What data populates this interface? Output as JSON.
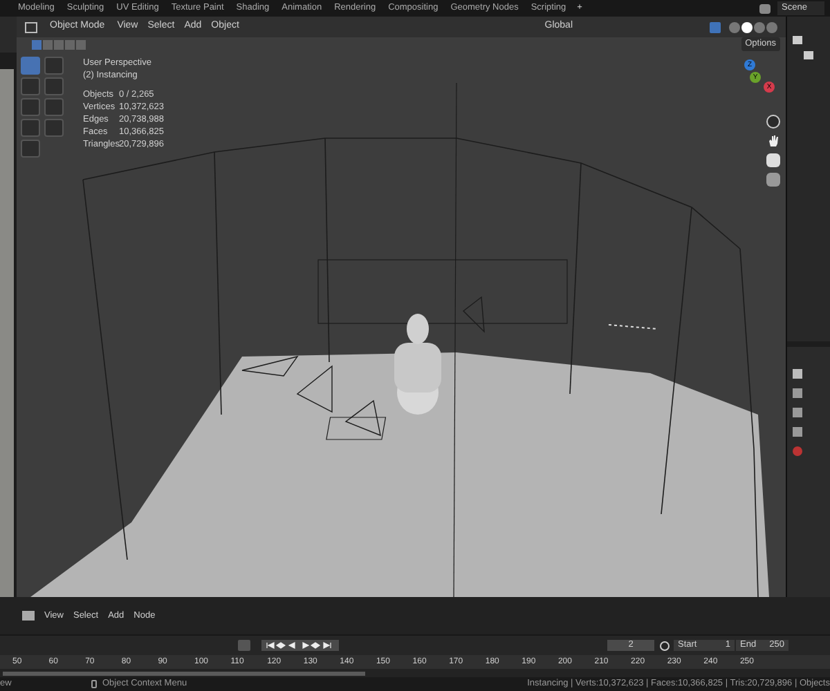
{
  "workspace_tabs": [
    {
      "label": "Modeling",
      "selected": false
    },
    {
      "label": "Sculpting",
      "selected": false
    },
    {
      "label": "UV Editing",
      "selected": false
    },
    {
      "label": "Texture Paint",
      "selected": false
    },
    {
      "label": "Shading",
      "selected": false
    },
    {
      "label": "Animation",
      "selected": false
    },
    {
      "label": "Rendering",
      "selected": false
    },
    {
      "label": "Compositing",
      "selected": false
    },
    {
      "label": "Geometry Nodes",
      "selected": false
    },
    {
      "label": "Scripting",
      "selected": false
    }
  ],
  "add_tab": "+",
  "scene": "Scene",
  "viewport": {
    "mode": "Object Mode",
    "menus": [
      "View",
      "Select",
      "Add",
      "Object"
    ],
    "orientation": "Global",
    "options": "Options",
    "select_modes": [
      {
        "selected": true
      },
      {
        "selected": false
      },
      {
        "selected": false
      },
      {
        "selected": false
      },
      {
        "selected": false
      }
    ],
    "shading_modes": [
      {
        "selected": false
      },
      {
        "selected": true
      },
      {
        "selected": false
      },
      {
        "selected": false
      }
    ],
    "tools": [
      {
        "selected": true
      },
      {
        "selected": false
      },
      {
        "selected": false
      },
      {
        "selected": false
      },
      {
        "selected": false
      },
      {
        "selected": false
      },
      {
        "selected": false
      },
      {
        "selected": false
      },
      {
        "selected": false
      }
    ],
    "view_name": "User Perspective",
    "collection": "(2) Instancing",
    "stats": [
      {
        "label": "Objects",
        "value": "0 / 2,265"
      },
      {
        "label": "Vertices",
        "value": "10,372,623"
      },
      {
        "label": "Edges",
        "value": "20,738,988"
      },
      {
        "label": "Faces",
        "value": "10,366,825"
      },
      {
        "label": "Triangles",
        "value": "20,729,896"
      }
    ],
    "gizmo_axes": [
      {
        "label": "Z",
        "color": "#2f7ad6"
      },
      {
        "label": "Y",
        "color": "#6aa22a"
      },
      {
        "label": "X",
        "color": "#d53b4c"
      }
    ]
  },
  "node_editor": {
    "menus": [
      "View",
      "Select",
      "Add",
      "Node"
    ]
  },
  "timeline": {
    "current_frame": "2",
    "start_label": "Start",
    "start": "1",
    "end_label": "End",
    "end": "250",
    "ruler": [
      "50",
      "60",
      "70",
      "80",
      "90",
      "100",
      "110",
      "120",
      "130",
      "140",
      "150",
      "160",
      "170",
      "180",
      "190",
      "200",
      "210",
      "220",
      "230",
      "240",
      "250"
    ]
  },
  "status_bar": {
    "left": "ew",
    "context": "Object Context Menu",
    "stats": "Instancing | Verts:10,372,623 | Faces:10,366,825 | Tris:20,729,896 | Objects"
  }
}
